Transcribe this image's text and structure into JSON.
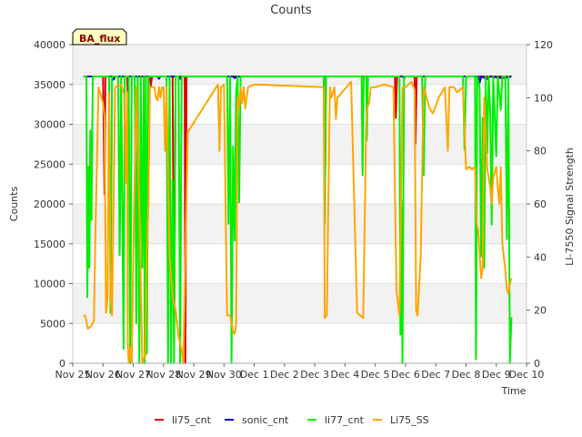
{
  "chart_data": {
    "type": "line",
    "title": "Counts",
    "xlabel": "Time",
    "ylabel": "Counts",
    "y2label": "LI-7550 Signal Strength",
    "badge": "BA_flux",
    "xlim": [
      0,
      15
    ],
    "ylim": [
      0,
      40000
    ],
    "y2lim": [
      0,
      120
    ],
    "x_ticks": [
      {
        "x": 0,
        "label": "Nov 25"
      },
      {
        "x": 1,
        "label": "Nov 26"
      },
      {
        "x": 2,
        "label": "Nov 27"
      },
      {
        "x": 3,
        "label": "Nov 28"
      },
      {
        "x": 4,
        "label": "Nov 29"
      },
      {
        "x": 5,
        "label": "Nov 30"
      },
      {
        "x": 6,
        "label": "Dec 1"
      },
      {
        "x": 7,
        "label": "Dec 2"
      },
      {
        "x": 8,
        "label": "Dec 3"
      },
      {
        "x": 9,
        "label": "Dec 4"
      },
      {
        "x": 10,
        "label": "Dec 5"
      },
      {
        "x": 11,
        "label": "Dec 6"
      },
      {
        "x": 12,
        "label": "Dec 7"
      },
      {
        "x": 13,
        "label": "Dec 8"
      },
      {
        "x": 14,
        "label": "Dec 9"
      },
      {
        "x": 15,
        "label": "Dec 10"
      }
    ],
    "y_ticks": [
      0,
      5000,
      10000,
      15000,
      20000,
      25000,
      30000,
      35000,
      40000
    ],
    "y2_ticks": [
      0,
      20,
      40,
      60,
      80,
      100,
      120
    ],
    "legend_position": "bottom",
    "series": [
      {
        "name": "li75_cnt",
        "color": "#dd0000",
        "axis": "left",
        "points": [
          [
            0.35,
            36000
          ],
          [
            1.0,
            36000
          ],
          [
            1.05,
            21200
          ],
          [
            1.08,
            36000
          ],
          [
            1.8,
            36000
          ],
          [
            1.82,
            33500
          ],
          [
            1.85,
            36000
          ],
          [
            2.55,
            36000
          ],
          [
            2.58,
            34800
          ],
          [
            2.62,
            36000
          ],
          [
            3.3,
            36000
          ],
          [
            3.35,
            2800
          ],
          [
            3.4,
            36000
          ],
          [
            3.7,
            36000
          ],
          [
            3.72,
            0
          ],
          [
            3.76,
            36000
          ],
          [
            8.3,
            36000
          ],
          [
            8.33,
            17600
          ],
          [
            8.37,
            36000
          ],
          [
            10.65,
            36000
          ],
          [
            10.68,
            30800
          ],
          [
            10.72,
            36000
          ],
          [
            11.3,
            36000
          ],
          [
            11.33,
            27500
          ],
          [
            11.37,
            36000
          ],
          [
            14.5,
            36000
          ]
        ]
      },
      {
        "name": "sonic_cnt",
        "color": "#0000cc",
        "axis": "left",
        "points": [
          [
            0.35,
            36000
          ],
          [
            1.3,
            36000
          ],
          [
            1.35,
            35600
          ],
          [
            1.4,
            36000
          ],
          [
            2.8,
            36000
          ],
          [
            2.85,
            35700
          ],
          [
            2.9,
            36000
          ],
          [
            3.5,
            36000
          ],
          [
            3.55,
            35700
          ],
          [
            3.6,
            36000
          ],
          [
            5.3,
            36000
          ],
          [
            5.35,
            35800
          ],
          [
            5.45,
            36000
          ],
          [
            10.9,
            36000
          ],
          [
            10.95,
            35800
          ],
          [
            11.0,
            36000
          ],
          [
            13.4,
            36000
          ],
          [
            13.45,
            35200
          ],
          [
            13.5,
            36000
          ],
          [
            13.7,
            35700
          ],
          [
            13.8,
            36000
          ],
          [
            14.2,
            35800
          ],
          [
            14.5,
            36000
          ]
        ]
      },
      {
        "name": "li77_cnt",
        "color": "#00ee00",
        "axis": "left",
        "points": [
          [
            0.35,
            36000
          ],
          [
            0.45,
            36000
          ],
          [
            0.48,
            8300
          ],
          [
            0.52,
            24700
          ],
          [
            0.55,
            12000
          ],
          [
            0.58,
            29200
          ],
          [
            0.62,
            18000
          ],
          [
            0.66,
            36000
          ],
          [
            1.2,
            36000
          ],
          [
            1.25,
            6300
          ],
          [
            1.3,
            36000
          ],
          [
            1.5,
            36000
          ],
          [
            1.55,
            13600
          ],
          [
            1.6,
            36000
          ],
          [
            1.68,
            1800
          ],
          [
            1.72,
            36000
          ],
          [
            1.85,
            36000
          ],
          [
            1.9,
            0
          ],
          [
            1.95,
            36000
          ],
          [
            2.05,
            36000
          ],
          [
            2.1,
            5000
          ],
          [
            2.15,
            36000
          ],
          [
            2.2,
            0
          ],
          [
            2.25,
            36000
          ],
          [
            2.3,
            12000
          ],
          [
            2.35,
            36000
          ],
          [
            2.38,
            0
          ],
          [
            2.42,
            36000
          ],
          [
            2.45,
            1200
          ],
          [
            2.5,
            36000
          ],
          [
            3.1,
            36000
          ],
          [
            3.15,
            0
          ],
          [
            3.2,
            36000
          ],
          [
            3.25,
            0
          ],
          [
            3.3,
            23000
          ],
          [
            3.35,
            0
          ],
          [
            3.4,
            36000
          ],
          [
            3.5,
            36000
          ],
          [
            3.55,
            0
          ],
          [
            3.6,
            36000
          ],
          [
            5.1,
            36000
          ],
          [
            5.15,
            17500
          ],
          [
            5.2,
            36000
          ],
          [
            5.25,
            0
          ],
          [
            5.3,
            27200
          ],
          [
            5.35,
            15400
          ],
          [
            5.4,
            34000
          ],
          [
            5.45,
            36000
          ],
          [
            5.5,
            20200
          ],
          [
            5.55,
            36000
          ],
          [
            8.3,
            36000
          ],
          [
            8.33,
            17600
          ],
          [
            8.37,
            36000
          ],
          [
            9.55,
            36000
          ],
          [
            9.58,
            23600
          ],
          [
            9.62,
            36000
          ],
          [
            9.7,
            36000
          ],
          [
            9.72,
            28000
          ],
          [
            9.76,
            36000
          ],
          [
            10.8,
            36000
          ],
          [
            10.83,
            3600
          ],
          [
            10.86,
            20500
          ],
          [
            10.9,
            0
          ],
          [
            10.95,
            36000
          ],
          [
            11.55,
            36000
          ],
          [
            11.6,
            23600
          ],
          [
            11.65,
            36000
          ],
          [
            12.9,
            36000
          ],
          [
            12.95,
            26800
          ],
          [
            13.0,
            36000
          ],
          [
            13.3,
            36000
          ],
          [
            13.33,
            500
          ],
          [
            13.37,
            36000
          ],
          [
            13.45,
            34600
          ],
          [
            13.5,
            13400
          ],
          [
            13.55,
            30800
          ],
          [
            13.6,
            12000
          ],
          [
            13.65,
            36000
          ],
          [
            13.7,
            26400
          ],
          [
            13.75,
            36000
          ],
          [
            13.8,
            31500
          ],
          [
            13.85,
            17400
          ],
          [
            13.9,
            36000
          ],
          [
            14.0,
            26000
          ],
          [
            14.05,
            36000
          ],
          [
            14.15,
            31800
          ],
          [
            14.2,
            36000
          ],
          [
            14.3,
            36000
          ],
          [
            14.35,
            15600
          ],
          [
            14.4,
            36000
          ],
          [
            14.45,
            0
          ],
          [
            14.5,
            5800
          ]
        ]
      },
      {
        "name": "Li75_SS",
        "color": "#ffa500",
        "axis": "right",
        "points": [
          [
            0.35,
            18
          ],
          [
            0.4,
            18
          ],
          [
            0.45,
            16
          ],
          [
            0.5,
            13
          ],
          [
            0.6,
            14
          ],
          [
            0.7,
            16
          ],
          [
            0.75,
            50
          ],
          [
            0.85,
            104
          ],
          [
            1.0,
            98
          ],
          [
            1.05,
            93
          ],
          [
            1.1,
            19
          ],
          [
            1.15,
            24
          ],
          [
            1.2,
            102
          ],
          [
            1.25,
            26
          ],
          [
            1.3,
            18
          ],
          [
            1.4,
            104
          ],
          [
            1.6,
            105
          ],
          [
            1.7,
            101
          ],
          [
            1.75,
            68
          ],
          [
            1.8,
            102
          ],
          [
            1.82,
            8
          ],
          [
            1.85,
            0
          ],
          [
            1.9,
            6
          ],
          [
            1.95,
            0
          ],
          [
            2.0,
            40
          ],
          [
            2.1,
            104
          ],
          [
            2.2,
            60
          ],
          [
            2.3,
            0
          ],
          [
            2.4,
            3
          ],
          [
            2.45,
            43
          ],
          [
            2.5,
            60
          ],
          [
            2.55,
            104
          ],
          [
            2.7,
            104
          ],
          [
            2.75,
            100
          ],
          [
            2.8,
            99
          ],
          [
            2.85,
            104
          ],
          [
            2.9,
            100
          ],
          [
            2.95,
            104
          ],
          [
            3.0,
            104
          ],
          [
            3.05,
            80
          ],
          [
            3.1,
            104
          ],
          [
            3.2,
            40
          ],
          [
            3.3,
            25
          ],
          [
            3.4,
            20
          ],
          [
            3.5,
            10
          ],
          [
            3.6,
            5
          ],
          [
            3.65,
            0
          ],
          [
            3.7,
            25
          ],
          [
            3.8,
            87
          ],
          [
            4.8,
            105
          ],
          [
            4.85,
            80
          ],
          [
            4.9,
            104
          ],
          [
            5.0,
            105
          ],
          [
            5.1,
            18
          ],
          [
            5.2,
            18
          ],
          [
            5.3,
            12
          ],
          [
            5.35,
            11
          ],
          [
            5.4,
            14
          ],
          [
            5.45,
            100
          ],
          [
            5.5,
            96
          ],
          [
            5.55,
            104
          ],
          [
            5.6,
            98
          ],
          [
            5.65,
            104
          ],
          [
            5.7,
            96
          ],
          [
            5.8,
            104
          ],
          [
            6.0,
            105
          ],
          [
            8.3,
            104
          ],
          [
            8.33,
            17
          ],
          [
            8.4,
            18
          ],
          [
            8.5,
            104
          ],
          [
            8.55,
            100
          ],
          [
            8.6,
            102
          ],
          [
            8.65,
            104
          ],
          [
            8.7,
            92
          ],
          [
            8.75,
            100
          ],
          [
            9.2,
            106
          ],
          [
            9.4,
            19
          ],
          [
            9.6,
            17
          ],
          [
            9.7,
            90
          ],
          [
            9.75,
            97
          ],
          [
            9.8,
            98
          ],
          [
            9.85,
            104
          ],
          [
            9.9,
            104
          ],
          [
            10.0,
            104
          ],
          [
            10.3,
            105
          ],
          [
            10.6,
            104
          ],
          [
            10.7,
            27
          ],
          [
            10.8,
            18
          ],
          [
            10.9,
            104
          ],
          [
            11.0,
            104
          ],
          [
            11.2,
            106
          ],
          [
            11.3,
            103
          ],
          [
            11.35,
            20
          ],
          [
            11.4,
            18
          ],
          [
            11.5,
            40
          ],
          [
            11.6,
            104
          ],
          [
            11.8,
            96
          ],
          [
            11.9,
            94
          ],
          [
            12.1,
            100
          ],
          [
            12.3,
            104
          ],
          [
            12.4,
            80
          ],
          [
            12.45,
            104
          ],
          [
            12.6,
            104
          ],
          [
            12.7,
            102
          ],
          [
            12.9,
            104
          ],
          [
            13.0,
            73
          ],
          [
            13.1,
            74
          ],
          [
            13.2,
            73
          ],
          [
            13.3,
            74
          ],
          [
            13.35,
            53
          ],
          [
            13.4,
            50
          ],
          [
            13.5,
            32
          ],
          [
            13.55,
            36
          ],
          [
            13.6,
            100
          ],
          [
            13.7,
            73
          ],
          [
            13.75,
            70
          ],
          [
            13.8,
            66
          ],
          [
            13.85,
            60
          ],
          [
            13.9,
            70
          ],
          [
            14.0,
            74
          ],
          [
            14.05,
            66
          ],
          [
            14.1,
            60
          ],
          [
            14.15,
            74
          ],
          [
            14.2,
            45
          ],
          [
            14.3,
            35
          ],
          [
            14.35,
            28
          ],
          [
            14.4,
            26
          ],
          [
            14.45,
            30
          ],
          [
            14.5,
            32
          ]
        ]
      }
    ]
  }
}
